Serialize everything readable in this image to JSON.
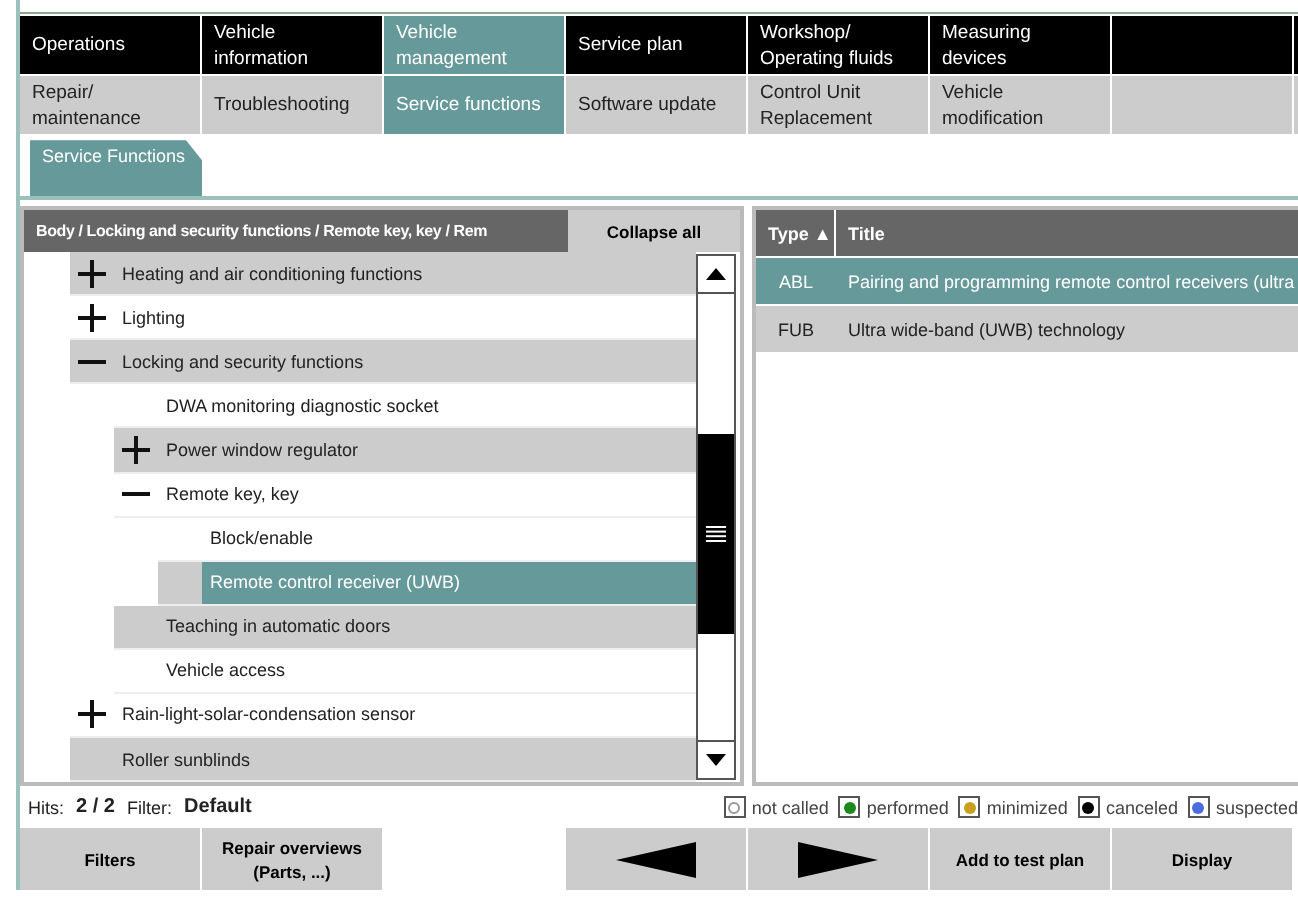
{
  "main_tabs": [
    {
      "label": "Operations",
      "selected": false
    },
    {
      "label": "Vehicle information",
      "selected": false
    },
    {
      "label": "Vehicle management",
      "selected": true
    },
    {
      "label": "Service plan",
      "selected": false
    },
    {
      "label": "Workshop/ Operating fluids",
      "selected": false
    },
    {
      "label": "Measuring devices",
      "selected": false
    }
  ],
  "sub_tabs": [
    {
      "label": "Repair/ maintenance",
      "selected": false
    },
    {
      "label": "Troubleshooting",
      "selected": false
    },
    {
      "label": "Service functions",
      "selected": true
    },
    {
      "label": "Software update",
      "selected": false
    },
    {
      "label": "Control Unit Replacement",
      "selected": false
    },
    {
      "label": "Vehicle modification",
      "selected": false
    }
  ],
  "page_tab": {
    "label": "Service Functions",
    "selected": true
  },
  "tree_panel": {
    "breadcrumb": "Body / Locking and security functions / Remote key, key / Rem",
    "collapse_button": "Collapse all",
    "items": [
      {
        "label": "Heating and air conditioning functions",
        "expanded": false,
        "shaded": true,
        "selected": false
      },
      {
        "label": "Lighting",
        "expanded": false,
        "shaded": false,
        "selected": false
      },
      {
        "label": "Locking and security functions",
        "expanded": true,
        "shaded": true,
        "selected": false,
        "children": [
          {
            "label": "DWA monitoring diagnostic socket",
            "shaded": false,
            "selected": false
          },
          {
            "label": "Power window regulator",
            "expanded": false,
            "shaded": true,
            "selected": false
          },
          {
            "label": "Remote key, key",
            "expanded": true,
            "shaded": false,
            "selected": false,
            "children": [
              {
                "label": "Block/enable",
                "shaded": false,
                "selected": false
              },
              {
                "label": "Remote control receiver (UWB)",
                "shaded": true,
                "selected": true
              }
            ]
          },
          {
            "label": "Teaching in automatic doors",
            "shaded": true,
            "selected": false
          },
          {
            "label": "Vehicle access",
            "shaded": false,
            "selected": false
          }
        ]
      },
      {
        "label": "Rain-light-solar-condensation sensor",
        "expanded": false,
        "shaded": false,
        "selected": false
      },
      {
        "label": "Roller sunblinds",
        "shaded": true,
        "selected": false
      }
    ]
  },
  "result_table": {
    "columns": [
      "Type ▲",
      "Title"
    ],
    "rows": [
      {
        "type": "ABL",
        "title": "Pairing and programming remote control receivers (ultra",
        "selected": true
      },
      {
        "type": "FUB",
        "title": "Ultra wide-band (UWB) technology",
        "selected": false
      }
    ]
  },
  "status": {
    "hits_label": "Hits:",
    "hits": "2 / 2",
    "filter_label": "Filter:",
    "filter": "Default"
  },
  "legend": [
    {
      "label": "not called",
      "color": "#ffffff"
    },
    {
      "label": "performed",
      "color": "#1a8a1a"
    },
    {
      "label": "minimized",
      "color": "#c8a020"
    },
    {
      "label": "canceled",
      "color": "#000000"
    },
    {
      "label": "suspected",
      "color": "#4a6ee0"
    }
  ],
  "buttons": [
    {
      "kind": "text",
      "label": "Filters"
    },
    {
      "kind": "text",
      "label": "Repair overviews (Parts, ...)"
    },
    {
      "kind": "spacer"
    },
    {
      "kind": "prev"
    },
    {
      "kind": "next"
    },
    {
      "kind": "text",
      "label": "Add to test plan"
    },
    {
      "kind": "text",
      "label": "Display"
    }
  ]
}
